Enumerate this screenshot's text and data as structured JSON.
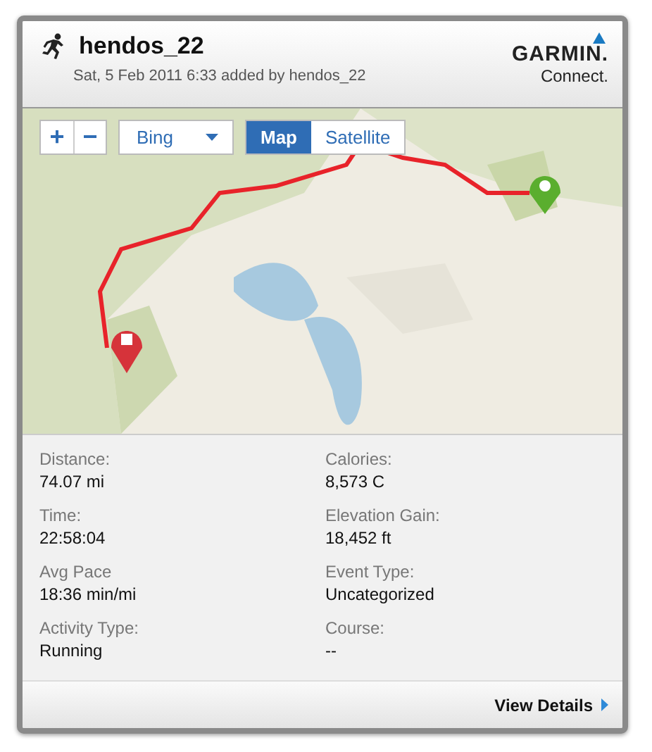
{
  "activity": {
    "user": "hendos_22",
    "subtitle": "Sat, 5 Feb 2011 6:33 added by hendos_22"
  },
  "logo": {
    "brand": "GARMIN.",
    "product": "Connect."
  },
  "map": {
    "kind": "picture",
    "zoom_in": "+",
    "zoom_out": "−",
    "provider": "Bing",
    "view_tabs": [
      {
        "label": "Map",
        "selected": true
      },
      {
        "label": "Satellite",
        "selected": false
      }
    ]
  },
  "stats": [
    {
      "label": "Distance:",
      "value": "74.07 mi"
    },
    {
      "label": "Calories:",
      "value": "8,573 C"
    },
    {
      "label": "Time:",
      "value": "22:58:04"
    },
    {
      "label": "Elevation Gain:",
      "value": "18,452 ft"
    },
    {
      "label": "Avg Pace",
      "value": "18:36 min/mi"
    },
    {
      "label": "Event Type:",
      "value": "Uncategorized"
    },
    {
      "label": "Activity Type:",
      "value": "Running"
    },
    {
      "label": "Course:",
      "value": "--"
    }
  ],
  "footer": {
    "link": "View Details"
  }
}
